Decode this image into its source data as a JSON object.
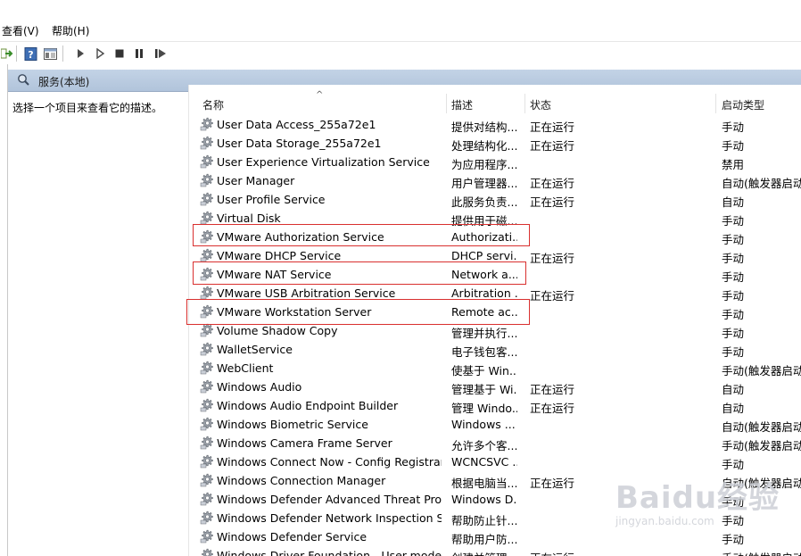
{
  "menu": {
    "view": "查看(V)",
    "help": "帮助(H)"
  },
  "toolbar": {
    "icons": [
      "export-list-icon",
      "help-icon",
      "console-tree-icon",
      "start-icon",
      "start-alt-icon",
      "stop-icon",
      "pause-icon",
      "restart-icon"
    ]
  },
  "header": {
    "title": "服务(本地)"
  },
  "description_pane": {
    "text": "选择一个项目来查看它的描述。"
  },
  "columns": {
    "name": "名称",
    "description": "描述",
    "status": "状态",
    "startup": "启动类型"
  },
  "services": [
    {
      "name": "User Data Access_255a72e1",
      "desc": "提供对结构...",
      "status": "正在运行",
      "startup": "手动"
    },
    {
      "name": "User Data Storage_255a72e1",
      "desc": "处理结构化...",
      "status": "正在运行",
      "startup": "手动"
    },
    {
      "name": "User Experience Virtualization Service",
      "desc": "为应用程序...",
      "status": "",
      "startup": "禁用"
    },
    {
      "name": "User Manager",
      "desc": "用户管理器...",
      "status": "正在运行",
      "startup": "自动(触发器启动)"
    },
    {
      "name": "User Profile Service",
      "desc": "此服务负责...",
      "status": "正在运行",
      "startup": "自动"
    },
    {
      "name": "Virtual Disk",
      "desc": "提供用于磁...",
      "status": "",
      "startup": "手动"
    },
    {
      "name": "VMware Authorization Service",
      "desc": "Authorizati...",
      "status": "",
      "startup": "手动"
    },
    {
      "name": "VMware DHCP Service",
      "desc": "DHCP servi...",
      "status": "正在运行",
      "startup": "手动"
    },
    {
      "name": "VMware NAT Service",
      "desc": "Network a...",
      "status": "",
      "startup": "手动"
    },
    {
      "name": "VMware USB Arbitration Service",
      "desc": "Arbitration ...",
      "status": "正在运行",
      "startup": "手动"
    },
    {
      "name": "VMware Workstation Server",
      "desc": "Remote ac...",
      "status": "",
      "startup": "手动"
    },
    {
      "name": "Volume Shadow Copy",
      "desc": "管理并执行...",
      "status": "",
      "startup": "手动"
    },
    {
      "name": "WalletService",
      "desc": "电子钱包客...",
      "status": "",
      "startup": "手动"
    },
    {
      "name": "WebClient",
      "desc": "使基于 Win...",
      "status": "",
      "startup": "手动(触发器启动)"
    },
    {
      "name": "Windows Audio",
      "desc": "管理基于 Wi...",
      "status": "正在运行",
      "startup": "自动"
    },
    {
      "name": "Windows Audio Endpoint Builder",
      "desc": "管理 Windo...",
      "status": "正在运行",
      "startup": "自动"
    },
    {
      "name": "Windows Biometric Service",
      "desc": "Windows ...",
      "status": "",
      "startup": "自动(触发器启动)"
    },
    {
      "name": "Windows Camera Frame Server",
      "desc": "允许多个客...",
      "status": "",
      "startup": "手动(触发器启动)"
    },
    {
      "name": "Windows Connect Now - Config Registrar",
      "desc": "WCNCSVC ...",
      "status": "",
      "startup": "手动"
    },
    {
      "name": "Windows Connection Manager",
      "desc": "根据电脑当...",
      "status": "正在运行",
      "startup": "自动(触发器启动)"
    },
    {
      "name": "Windows Defender Advanced Threat Prot...",
      "desc": "Windows D...",
      "status": "",
      "startup": "手动"
    },
    {
      "name": "Windows Defender Network Inspection S...",
      "desc": "帮助防止针...",
      "status": "",
      "startup": "手动"
    },
    {
      "name": "Windows Defender Service",
      "desc": "帮助用户防...",
      "status": "",
      "startup": "手动"
    },
    {
      "name": "Windows Driver Foundation - User-mode ...",
      "desc": "创建并管理...",
      "status": "正在运行",
      "startup": "手动(触发器启动)"
    }
  ],
  "watermark": {
    "text": "Baidu经验",
    "url": "jingyan.baidu.com"
  },
  "colors": {
    "header_bg": "#b8c9de",
    "annotation_red": "#d9302f",
    "gear_gray": "#8a8f96"
  }
}
